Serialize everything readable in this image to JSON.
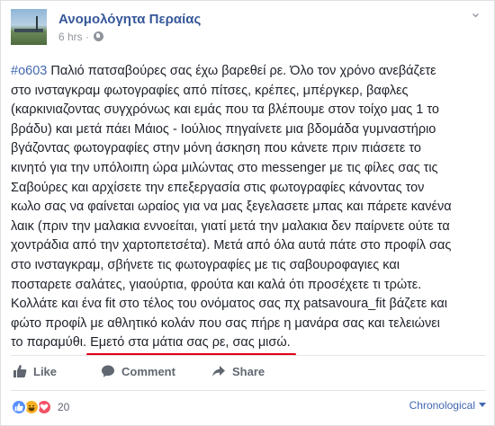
{
  "post": {
    "page_name": "Ανομολόγητα Περαίας",
    "time": "6 hrs",
    "separator": "·",
    "hashtag": "#ο603",
    "lines": [
      " Παλιό πατσαβούρες σας έχω βαρεθεί ρε. Όλο τον χρόνο ανεβάζετε",
      "στο ινσταγκραμ φωτογραφίες από πίτσες, κρέπες, μπέργκερ, βαφλες",
      "(καρκινιαζοντας συγχρόνως και εμάς που τα βλέπουμε στον τοίχο μας 1 το",
      "βράδυ) και μετά πάει Μάιος - Ιούλιος πηγαίνετε μια βδομάδα γυμναστήριο",
      "βγάζοντας φωτογραφίες στην μόνη άσκηση που κάνετε πριν πιάσετε το",
      "κινητό για την υπόλοιπη ώρα μιλώντας στο messenger με τις φίλες σας τις",
      "Σαβούρες και αρχίσετε την επεξεργασία στις φωτογραφίες κάνοντας τον",
      "κωλο σας να φαίνεται ωραίος για να μας ξεγελασετε μπας και πάρετε κανένα",
      "λαικ (πριν την μαλακια εννοείται, γιατί μετά την μαλακια δεν παίρνετε ούτε τα",
      "χοντράδια από την χαρτοπετσέτα). Μετά από όλα αυτά πάτε στο προφίλ σας",
      "στο ινσταγκραμ, σβήνετε τις φωτογραφίες με τις σαβουροφαγιες και",
      "ποσταρετε σαλάτες, γιαούρτια, φρούτα και καλά ότι προσέχετε τι τρώτε.",
      "Κολλάτε και ένα fit στο τέλος του ονόματος σας πχ patsavoura_fit βάζετε και",
      "φώτο προφίλ με αθλητικό κολάν που σας πήρε η μανάρα σας και τελειώνει"
    ],
    "last_line_plain": "το παραμύθι. ",
    "last_line_underlined": "Εμετό στα μάτια σας ρε, σας μισώ."
  },
  "actions": {
    "like_label": "Like",
    "comment_label": "Comment",
    "share_label": "Share"
  },
  "footer": {
    "reaction_count": "20",
    "sort_label": "Chronological"
  },
  "colors": {
    "link": "#365899",
    "hashtag": "#4267b2",
    "underline": "#e2001a",
    "like_reaction": "#5890ff",
    "haha_reaction": "#f7b125",
    "love_reaction": "#f25268"
  },
  "icons": [
    "avatar",
    "globe-icon",
    "more-options-icon",
    "like-icon",
    "comment-icon",
    "share-icon",
    "like-reaction-icon",
    "haha-reaction-icon",
    "love-reaction-icon"
  ]
}
